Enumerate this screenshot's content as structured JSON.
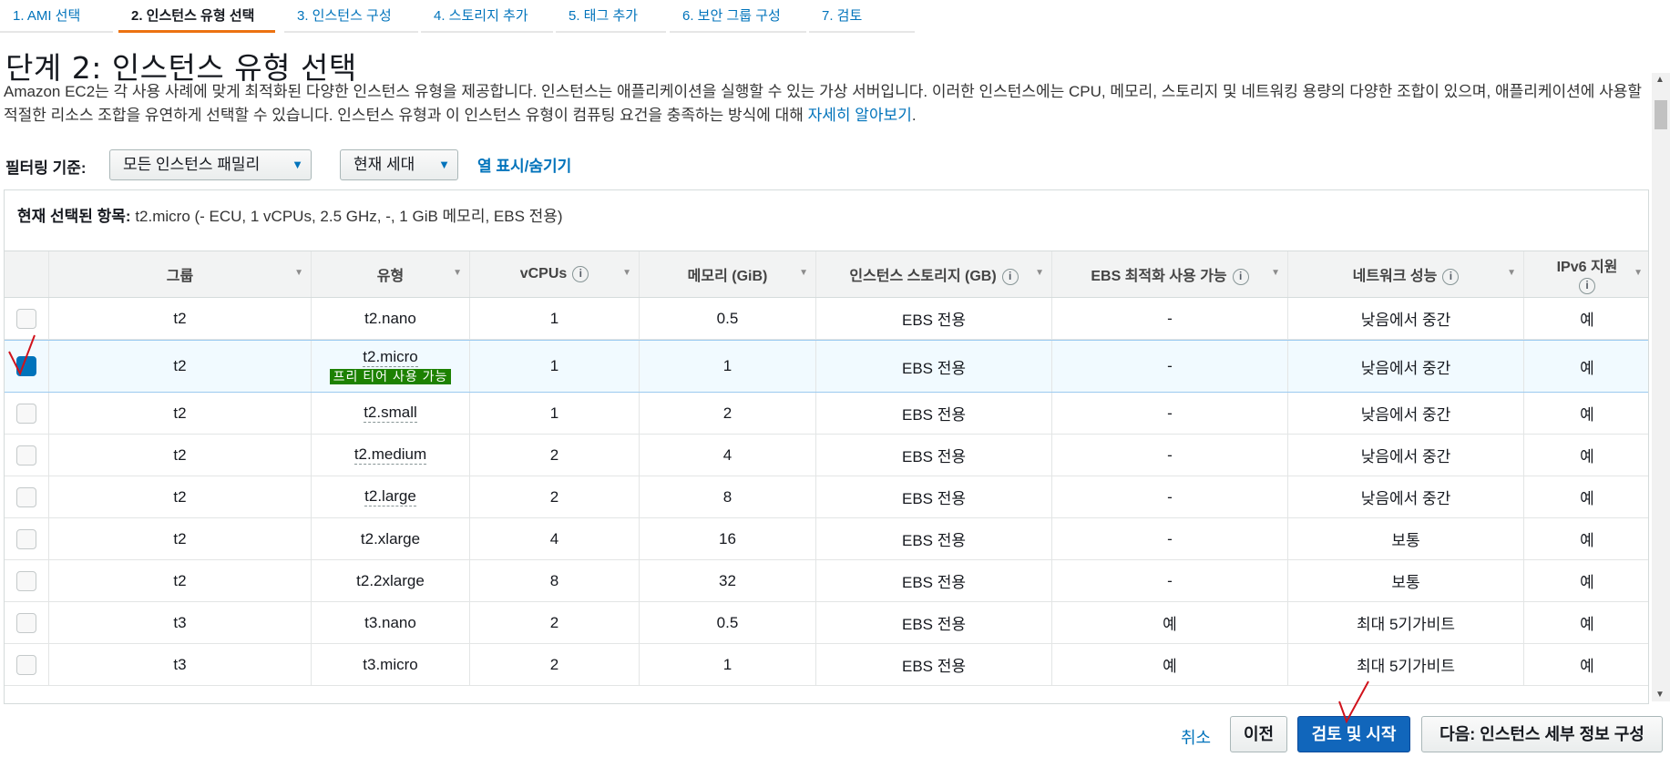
{
  "tabs": [
    {
      "label": "1. AMI 선택"
    },
    {
      "label": "2. 인스턴스 유형 선택"
    },
    {
      "label": "3. 인스턴스 구성"
    },
    {
      "label": "4. 스토리지 추가"
    },
    {
      "label": "5. 태그 추가"
    },
    {
      "label": "6. 보안 그룹 구성"
    },
    {
      "label": "7. 검토"
    }
  ],
  "page_title": "단계 2: 인스턴스 유형 선택",
  "description": {
    "text": "Amazon EC2는 각 사용 사례에 맞게 최적화된 다양한 인스턴스 유형을 제공합니다. 인스턴스는 애플리케이션을 실행할 수 있는 가상 서버입니다. 이러한 인스턴스에는 CPU, 메모리, 스토리지 및 네트워킹 용량의 다양한 조합이 있으며, 애플리케이션에 사용할 적절한 리소스 조합을 유연하게 선택할 수 있습니다. 인스턴스 유형과 이 인스턴스 유형이 컴퓨팅 요건을 충족하는 방식에 대해 ",
    "link": "자세히 알아보기",
    "end": "."
  },
  "filter": {
    "label": "필터링 기준:",
    "family_select": "모든 인스턴스 패밀리",
    "generation_select": "현재 세대",
    "column_toggle": "열 표시/숨기기"
  },
  "selected": {
    "label": "현재 선택된 항목:",
    "value": " t2.micro (- ECU, 1 vCPUs, 2.5 GHz, -, 1 GiB 메모리, EBS 전용)"
  },
  "table": {
    "headers": [
      "그룹",
      "유형",
      "vCPUs",
      "메모리 (GiB)",
      "인스턴스 스토리지 (GB)",
      "EBS 최적화 사용 가능",
      "네트워크 성능",
      "IPv6 지원"
    ],
    "free_tier_label": "프리 티어 사용 가능",
    "rows": [
      {
        "group": "t2",
        "type": "t2.nano",
        "vcpus": "1",
        "memory": "0.5",
        "storage": "EBS 전용",
        "ebs": "-",
        "network": "낮음에서 중간",
        "ipv6": "예"
      },
      {
        "group": "t2",
        "type": "t2.micro",
        "vcpus": "1",
        "memory": "1",
        "storage": "EBS 전용",
        "ebs": "-",
        "network": "낮음에서 중간",
        "ipv6": "예"
      },
      {
        "group": "t2",
        "type": "t2.small",
        "vcpus": "1",
        "memory": "2",
        "storage": "EBS 전용",
        "ebs": "-",
        "network": "낮음에서 중간",
        "ipv6": "예"
      },
      {
        "group": "t2",
        "type": "t2.medium",
        "vcpus": "2",
        "memory": "4",
        "storage": "EBS 전용",
        "ebs": "-",
        "network": "낮음에서 중간",
        "ipv6": "예"
      },
      {
        "group": "t2",
        "type": "t2.large",
        "vcpus": "2",
        "memory": "8",
        "storage": "EBS 전용",
        "ebs": "-",
        "network": "낮음에서 중간",
        "ipv6": "예"
      },
      {
        "group": "t2",
        "type": "t2.xlarge",
        "vcpus": "4",
        "memory": "16",
        "storage": "EBS 전용",
        "ebs": "-",
        "network": "보통",
        "ipv6": "예"
      },
      {
        "group": "t2",
        "type": "t2.2xlarge",
        "vcpus": "8",
        "memory": "32",
        "storage": "EBS 전용",
        "ebs": "-",
        "network": "보통",
        "ipv6": "예"
      },
      {
        "group": "t3",
        "type": "t3.nano",
        "vcpus": "2",
        "memory": "0.5",
        "storage": "EBS 전용",
        "ebs": "예",
        "network": "최대 5기가비트",
        "ipv6": "예"
      },
      {
        "group": "t3",
        "type": "t3.micro",
        "vcpus": "2",
        "memory": "1",
        "storage": "EBS 전용",
        "ebs": "예",
        "network": "최대 5기가비트",
        "ipv6": "예"
      }
    ]
  },
  "footer": {
    "cancel": "취소",
    "previous": "이전",
    "review_launch": "검토 및 시작",
    "next": "다음: 인스턴스 세부 정보 구성"
  },
  "colors": {
    "accent": "#0073bb",
    "tab_active_border": "#ec7211",
    "free_tier": "#1d8102",
    "primary_button": "#1166bb"
  }
}
